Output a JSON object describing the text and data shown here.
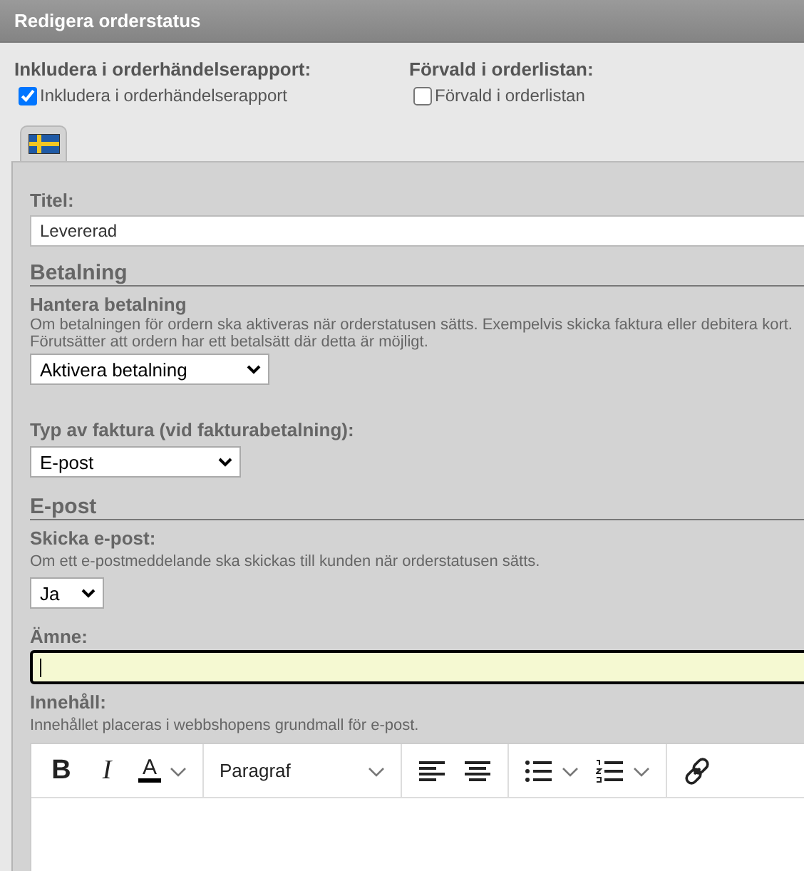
{
  "window": {
    "title": "Redigera orderstatus"
  },
  "options": [
    {
      "heading": "Inkludera i orderhändelserapport:",
      "label": "Inkludera i orderhändelserapport",
      "checked": true
    },
    {
      "heading": "Förvald i orderlistan:",
      "label": "Förvald i orderlistan",
      "checked": false
    }
  ],
  "language_tabs": [
    {
      "selected": true
    }
  ],
  "title_field": {
    "label": "Titel:",
    "value": "Levererad"
  },
  "sections": [
    {
      "heading": "Betalning",
      "fields": [
        {
          "kind": "select",
          "label": "Hantera betalning",
          "help": "Om betalningen för ordern ska aktiveras när orderstatusen sätts. Exempelvis skicka faktura eller debitera kort.\nFörutsätter att ordern har ett betalsätt där detta är möjligt.",
          "value": "Aktivera betalning"
        },
        {
          "kind": "select",
          "label": "Typ av faktura (vid fakturabetalning):",
          "value": "E-post"
        }
      ]
    },
    {
      "heading": "E-post",
      "fields": [
        {
          "kind": "select",
          "label": "Skicka e-post:",
          "help": "Om ett e-postmeddelande ska skickas till kunden när orderstatusen sätts.",
          "value": "Ja"
        },
        {
          "kind": "text",
          "label": "Ämne:",
          "focused": true
        },
        {
          "kind": "editor",
          "label": "Innehåll:",
          "help": "Innehållet placeras i webbshopens grundmall för e-post.",
          "toolbar": {
            "bold": "B",
            "italic": "I",
            "text_color": "A",
            "block_format": "Paragraf"
          }
        }
      ]
    }
  ]
}
